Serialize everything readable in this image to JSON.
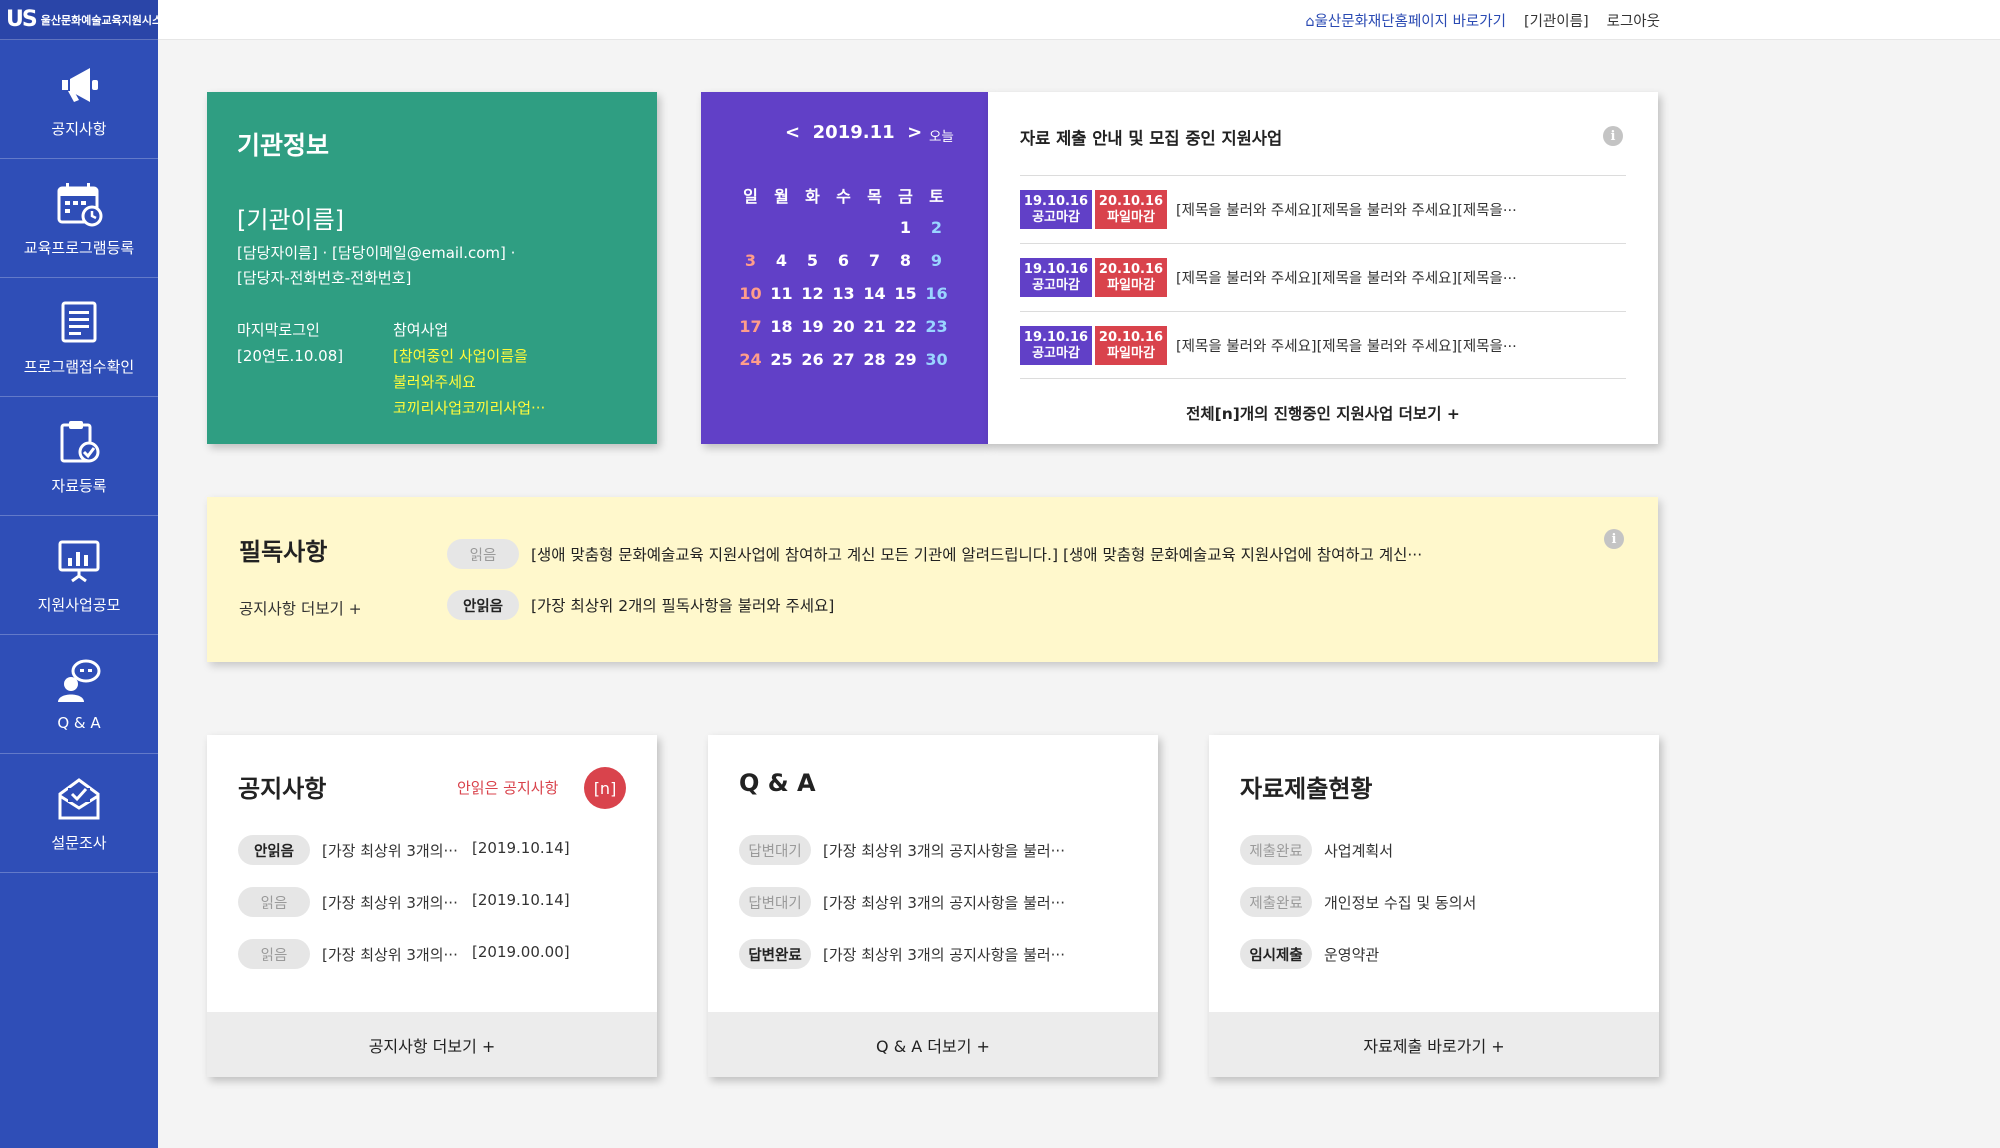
{
  "logo": {
    "mark": "US",
    "text": "울산문화예술교육지원시스템"
  },
  "sidebar": {
    "items": [
      {
        "label": "공지사항",
        "icon": "megaphone-icon"
      },
      {
        "label": "교육프로그램등록",
        "icon": "calendar-icon"
      },
      {
        "label": "프로그램접수확인",
        "icon": "document-icon"
      },
      {
        "label": "자료등록",
        "icon": "clipboard-check-icon"
      },
      {
        "label": "지원사업공모",
        "icon": "presentation-chart-icon"
      },
      {
        "label": "Q & A",
        "icon": "chat-user-icon"
      },
      {
        "label": "설문조사",
        "icon": "envelope-check-icon"
      }
    ]
  },
  "topbar": {
    "home_link": "울산문화재단홈페이지 바로가기",
    "org_name": "[기관이름]",
    "logout": "로그아웃"
  },
  "org_info": {
    "title": "기관정보",
    "name": "[기관이름]",
    "contact_line1": "[담당자이름] · [담당이메일@email.com] ·",
    "contact_line2": "[담당자-전화번호-전화번호]",
    "last_login_label": "마지막로그인",
    "last_login_value": "[20연도.10.08]",
    "participating_label": "참여사업",
    "participating_line1": "[참여중인 사업이름을",
    "participating_line2": "불러와주세요",
    "participating_line3": "코끼리사업코끼리사업···"
  },
  "calendar": {
    "prev": "<",
    "month": "2019.11",
    "next": ">",
    "today": "오늘",
    "weekdays": [
      "일",
      "월",
      "화",
      "수",
      "목",
      "금",
      "토"
    ],
    "weeks": [
      [
        "",
        "",
        "",
        "",
        "",
        "1",
        "2"
      ],
      [
        "3",
        "4",
        "5",
        "6",
        "7",
        "8",
        "9"
      ],
      [
        "10",
        "11",
        "12",
        "13",
        "14",
        "15",
        "16"
      ],
      [
        "17",
        "18",
        "19",
        "20",
        "21",
        "22",
        "23"
      ],
      [
        "24",
        "25",
        "26",
        "27",
        "28",
        "29",
        "30"
      ]
    ]
  },
  "support": {
    "title": "자료 제출 안내 및 모집 중인 지원사업",
    "rows": [
      {
        "d1": "19.10.16",
        "l1": "공고마감",
        "d2": "20.10.16",
        "l2": "파일마감",
        "text": "[제목을 불러와 주세요][제목을 불러와 주세요][제목을···"
      },
      {
        "d1": "19.10.16",
        "l1": "공고마감",
        "d2": "20.10.16",
        "l2": "파일마감",
        "text": "[제목을 불러와 주세요][제목을 불러와 주세요][제목을···"
      },
      {
        "d1": "19.10.16",
        "l1": "공고마감",
        "d2": "20.10.16",
        "l2": "파일마감",
        "text": "[제목을 불러와 주세요][제목을 불러와 주세요][제목을···"
      }
    ],
    "more": "전체[n]개의 진행중인 지원사업 더보기 +"
  },
  "must_read": {
    "title": "필독사항",
    "more": "공지사항 더보기 +",
    "rows": [
      {
        "status": "읽음",
        "text": "[생애 맞춤형 문화예술교육 지원사업에 참여하고 계신 모든 기관에 알려드립니다.] [생애 맞춤형 문화예술교육 지원사업에 참여하고 계신···"
      },
      {
        "status": "안읽음",
        "text": "[가장 최상위 2개의 필독사항을 불러와 주세요]"
      }
    ]
  },
  "notice": {
    "title": "공지사항",
    "unread_label": "안읽은 공지사항",
    "unread_count": "[n]",
    "rows": [
      {
        "status": "안읽음",
        "text": "[가장 최상위 3개의···",
        "date": "[2019.10.14]"
      },
      {
        "status": "읽음",
        "text": "[가장 최상위 3개의···",
        "date": "[2019.10.14]"
      },
      {
        "status": "읽음",
        "text": "[가장 최상위 3개의···",
        "date": "[2019.00.00]"
      }
    ],
    "footer": "공지사항 더보기 +"
  },
  "qa": {
    "title": "Q & A",
    "rows": [
      {
        "status": "답변대기",
        "text": "[가장 최상위 3개의 공지사항을 불러···"
      },
      {
        "status": "답변대기",
        "text": "[가장 최상위 3개의 공지사항을 불러···"
      },
      {
        "status": "답변완료",
        "text": "[가장 최상위 3개의 공지사항을 불러···"
      }
    ],
    "footer": "Q & A 더보기 +"
  },
  "docs": {
    "title": "자료제출현황",
    "rows": [
      {
        "status": "제출완료",
        "text": "사업계획서"
      },
      {
        "status": "제출완료",
        "text": "개인정보 수집 및 동의서"
      },
      {
        "status": "임시제출",
        "text": "운영약관"
      }
    ],
    "footer": "자료제출 바로가기 +"
  },
  "colors": {
    "sidebar": "#2f4eb7",
    "org_card": "#2f9e82",
    "calendar": "#6140c7",
    "alert_red": "#d9434c",
    "must_read_bg": "#fff8cc"
  }
}
